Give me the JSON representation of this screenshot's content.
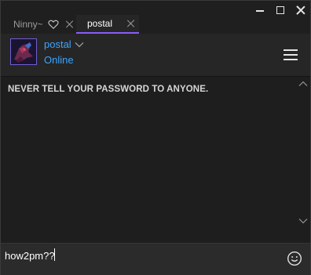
{
  "tabs": [
    {
      "label": "Ninny~",
      "active": false,
      "icon": "heart-icon"
    },
    {
      "label": "postal",
      "active": true
    }
  ],
  "window_controls": [
    "minimize",
    "maximize",
    "close"
  ],
  "contact": {
    "name": "postal",
    "status": "Online"
  },
  "chat": {
    "notice": "NEVER TELL YOUR PASSWORD TO ANYONE."
  },
  "composer": {
    "value": "how2pm??"
  },
  "colors": {
    "background": "#1e1e1e",
    "header": "#262626",
    "accent_link": "#3da4ff",
    "active_tab_underline": "#8a5cf6",
    "input_bar": "#2b2b2b"
  }
}
